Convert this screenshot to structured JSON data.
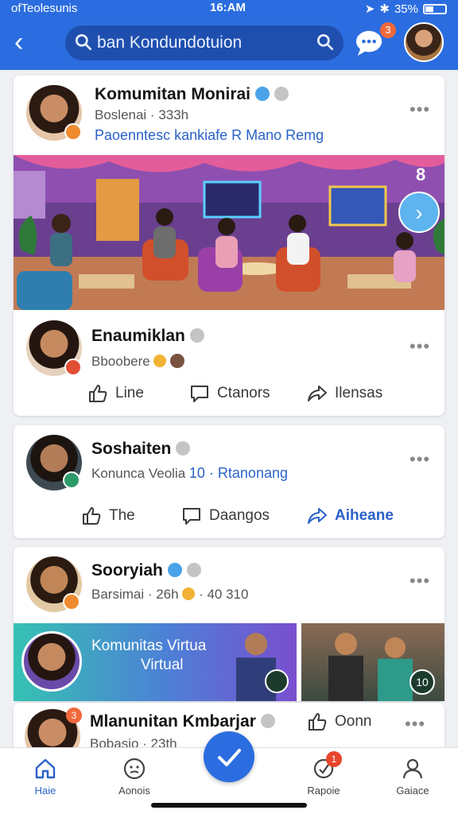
{
  "status": {
    "carrier": "ofTeolesunis",
    "time": "16:AM",
    "battery": "35%"
  },
  "header": {
    "search_value": "ban Kondundotuion",
    "chat_badge": "3"
  },
  "posts": [
    {
      "name": "Komumitan Monirai",
      "meta": "Boslenai · 333h",
      "link": "Paoenntesc kankiafe R Mano Remg",
      "image_counter": "8",
      "comment": {
        "name": "Enaumiklan",
        "meta": "Bboobere"
      },
      "actions": [
        "Line",
        "Ctanors",
        "Ilensas"
      ]
    },
    {
      "name": "Soshaiten",
      "meta": "Konunca Veolia",
      "link": "10 · Rtanonang",
      "actions": [
        "The",
        "Daangos",
        "Aiheane"
      ]
    },
    {
      "name": "Sooryiah",
      "meta": "Barsimai · 26h",
      "meta_extra": "· 40 310",
      "banner": {
        "title": "Komunitas Virtua",
        "subtitle": "Virtual"
      },
      "thumb_badge": "10"
    },
    {
      "name": "Mlanunitan Kmbarjar",
      "meta": "Bobasio · 23th",
      "badge": "3",
      "action": "Oonn"
    }
  ],
  "bottom_nav": [
    {
      "label": "Haie",
      "icon": "home-icon",
      "active": true
    },
    {
      "label": "Aonois",
      "icon": "face-icon"
    },
    {
      "label": "Rapoie",
      "icon": "notification-icon",
      "badge": "1"
    },
    {
      "label": "Gaiace",
      "icon": "profile-icon"
    }
  ],
  "colors": {
    "primary": "#2b6de0",
    "link": "#2a62c9",
    "background": "#eef0f4"
  }
}
